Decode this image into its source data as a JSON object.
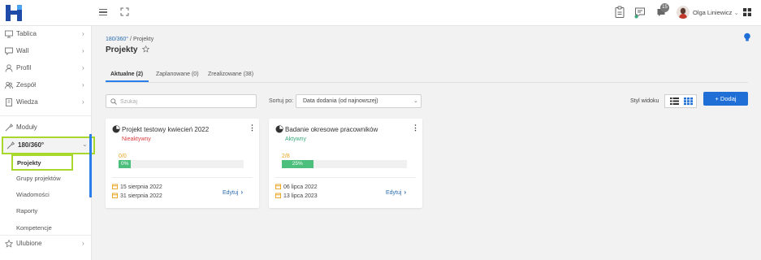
{
  "topbar": {
    "notification_count": "15",
    "user_name": "Olga Liniewicz",
    "user_chevron": "⌄"
  },
  "sidebar": {
    "items": [
      {
        "label": "Tablica",
        "icon": "monitor-icon"
      },
      {
        "label": "Wall",
        "icon": "chat-icon"
      },
      {
        "label": "Profil",
        "icon": "user-icon"
      },
      {
        "label": "Zespół",
        "icon": "team-icon"
      },
      {
        "label": "Wiedza",
        "icon": "book-icon"
      },
      {
        "label": "Moduły",
        "icon": "tools-icon"
      },
      {
        "label": "180/360°",
        "icon": "tools-icon"
      },
      {
        "label": "Ulubione",
        "icon": "star-icon"
      }
    ],
    "subitems": [
      "Projekty",
      "Grupy projektów",
      "Wiadomości",
      "Raporty",
      "Kompetencje"
    ],
    "chevron_right": "›",
    "chevron_down": "⌄"
  },
  "breadcrumb": {
    "root": "180/360°",
    "sep": " / ",
    "current": "Projekty"
  },
  "page_title": "Projekty",
  "tabs": [
    {
      "label": "Aktualne (2)"
    },
    {
      "label": "Zaplanowane (0)"
    },
    {
      "label": "Zrealizowane (38)"
    }
  ],
  "search": {
    "placeholder": "Szukaj"
  },
  "sort": {
    "label": "Sortuj po:",
    "value": "Data dodania (od najnowszej)",
    "chevron": "⌄"
  },
  "view": {
    "label": "Styl widoku"
  },
  "add_button": "+ Dodaj",
  "colors": {
    "accent": "#1f6fd6",
    "inactive": "#d94040",
    "active": "#3aa87a",
    "progress": "#4cbf7c",
    "count": "#e8a21a",
    "highlight": "#a8d82b"
  },
  "cards": [
    {
      "title": "Projekt testowy kwiecień 2022",
      "status": "Nieaktywny",
      "status_kind": "inactive",
      "count": "0/0",
      "progress_label": "0%",
      "progress": 0.1,
      "start_date": "15 sierpnia 2022",
      "end_date": "31 sierpnia 2022",
      "edit": "Edytuj",
      "menu": "⋮",
      "arrow": "›"
    },
    {
      "title": "Badanie okresowe pracowników",
      "status": "Aktywny",
      "status_kind": "active",
      "count": "2/8",
      "progress_label": "25%",
      "progress": 0.25,
      "start_date": "06 lipca 2022",
      "end_date": "13 lipca 2023",
      "edit": "Edytuj",
      "menu": "⋮",
      "arrow": "›"
    }
  ]
}
